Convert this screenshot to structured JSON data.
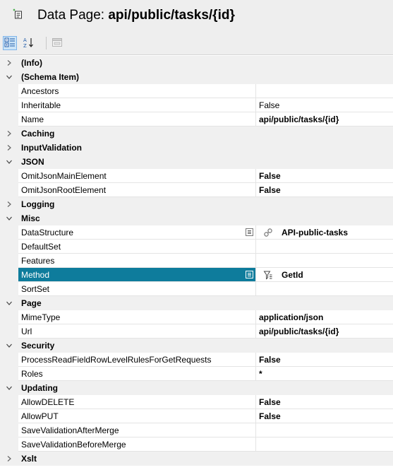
{
  "header": {
    "prefix": "Data Page: ",
    "name": "api/public/tasks/{id}",
    "icon": "data-page-icon"
  },
  "toolbar": {
    "buttons": [
      {
        "name": "categorized-view",
        "icon": "categorized-icon",
        "active": true
      },
      {
        "name": "alphabetical-sort",
        "icon": "sort-az-icon",
        "active": false
      },
      {
        "name": "property-pages",
        "icon": "property-pages-icon",
        "active": false,
        "disabled": true
      }
    ]
  },
  "grid": {
    "info": {
      "label": "(Info)",
      "expanded": false
    },
    "schema_item": {
      "label": "(Schema Item)",
      "expanded": true,
      "ancestors": {
        "name": "Ancestors",
        "value": ""
      },
      "inheritable": {
        "name": "Inheritable",
        "value": "False"
      },
      "name": {
        "name": "Name",
        "value": "api/public/tasks/{id}"
      }
    },
    "caching": {
      "label": "Caching",
      "expanded": false
    },
    "input_validation": {
      "label": "InputValidation",
      "expanded": false
    },
    "json": {
      "label": "JSON",
      "expanded": true,
      "omit_main": {
        "name": "OmitJsonMainElement",
        "value": "False"
      },
      "omit_root": {
        "name": "OmitJsonRootElement",
        "value": "False"
      }
    },
    "logging": {
      "label": "Logging",
      "expanded": false
    },
    "misc": {
      "label": "Misc",
      "expanded": true,
      "data_structure": {
        "name": "DataStructure",
        "value": "API-public-tasks",
        "icon": "link-icon"
      },
      "default_set": {
        "name": "DefaultSet",
        "value": ""
      },
      "features": {
        "name": "Features",
        "value": ""
      },
      "method": {
        "name": "Method",
        "value": "GetId",
        "icon": "filter-method-icon",
        "selected": true
      },
      "sort_set": {
        "name": "SortSet",
        "value": ""
      }
    },
    "page": {
      "label": "Page",
      "expanded": true,
      "mime_type": {
        "name": "MimeType",
        "value": "application/json"
      },
      "url": {
        "name": "Url",
        "value": "api/public/tasks/{id}"
      }
    },
    "security": {
      "label": "Security",
      "expanded": true,
      "process_read": {
        "name": "ProcessReadFieldRowLevelRulesForGetRequests",
        "value": "False"
      },
      "roles": {
        "name": "Roles",
        "value": "*"
      }
    },
    "updating": {
      "label": "Updating",
      "expanded": true,
      "allow_delete": {
        "name": "AllowDELETE",
        "value": "False"
      },
      "allow_put": {
        "name": "AllowPUT",
        "value": "False"
      },
      "save_after": {
        "name": "SaveValidationAfterMerge",
        "value": ""
      },
      "save_before": {
        "name": "SaveValidationBeforeMerge",
        "value": ""
      }
    },
    "xslt": {
      "label": "Xslt",
      "expanded": false
    }
  },
  "colors": {
    "selected_background": "#0e7c9c",
    "category_background": "#f0f0f0",
    "header_background": "#eeeeee"
  }
}
